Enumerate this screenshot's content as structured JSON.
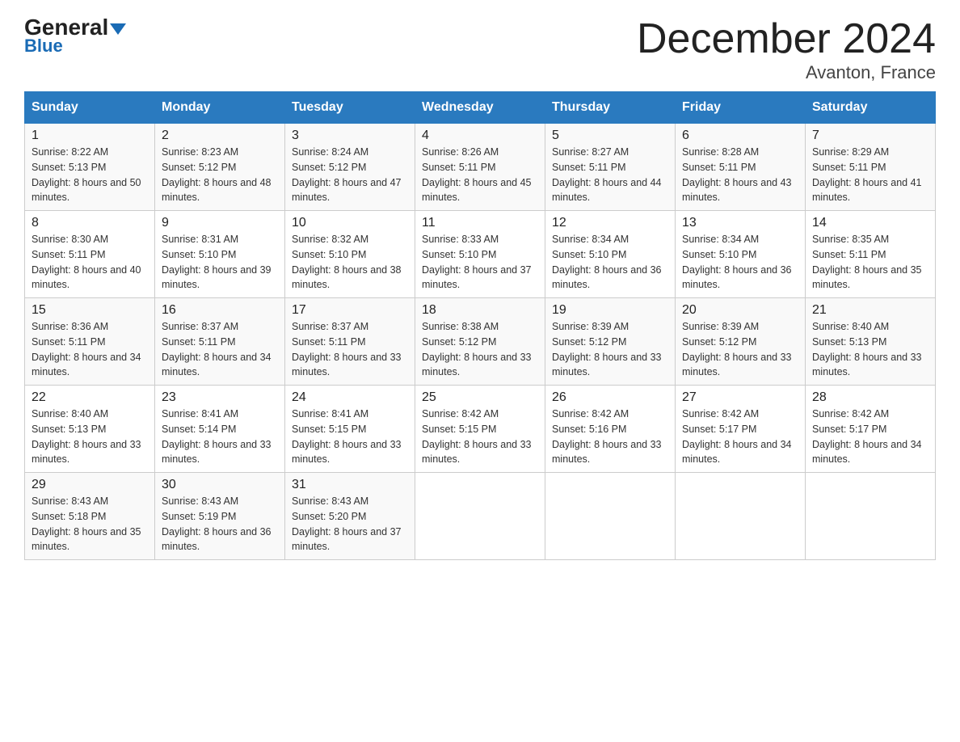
{
  "logo": {
    "general": "General",
    "blue": "Blue"
  },
  "title": "December 2024",
  "location": "Avanton, France",
  "days_header": [
    "Sunday",
    "Monday",
    "Tuesday",
    "Wednesday",
    "Thursday",
    "Friday",
    "Saturday"
  ],
  "weeks": [
    [
      {
        "day": "1",
        "sunrise": "8:22 AM",
        "sunset": "5:13 PM",
        "daylight": "8 hours and 50 minutes."
      },
      {
        "day": "2",
        "sunrise": "8:23 AM",
        "sunset": "5:12 PM",
        "daylight": "8 hours and 48 minutes."
      },
      {
        "day": "3",
        "sunrise": "8:24 AM",
        "sunset": "5:12 PM",
        "daylight": "8 hours and 47 minutes."
      },
      {
        "day": "4",
        "sunrise": "8:26 AM",
        "sunset": "5:11 PM",
        "daylight": "8 hours and 45 minutes."
      },
      {
        "day": "5",
        "sunrise": "8:27 AM",
        "sunset": "5:11 PM",
        "daylight": "8 hours and 44 minutes."
      },
      {
        "day": "6",
        "sunrise": "8:28 AM",
        "sunset": "5:11 PM",
        "daylight": "8 hours and 43 minutes."
      },
      {
        "day": "7",
        "sunrise": "8:29 AM",
        "sunset": "5:11 PM",
        "daylight": "8 hours and 41 minutes."
      }
    ],
    [
      {
        "day": "8",
        "sunrise": "8:30 AM",
        "sunset": "5:11 PM",
        "daylight": "8 hours and 40 minutes."
      },
      {
        "day": "9",
        "sunrise": "8:31 AM",
        "sunset": "5:10 PM",
        "daylight": "8 hours and 39 minutes."
      },
      {
        "day": "10",
        "sunrise": "8:32 AM",
        "sunset": "5:10 PM",
        "daylight": "8 hours and 38 minutes."
      },
      {
        "day": "11",
        "sunrise": "8:33 AM",
        "sunset": "5:10 PM",
        "daylight": "8 hours and 37 minutes."
      },
      {
        "day": "12",
        "sunrise": "8:34 AM",
        "sunset": "5:10 PM",
        "daylight": "8 hours and 36 minutes."
      },
      {
        "day": "13",
        "sunrise": "8:34 AM",
        "sunset": "5:10 PM",
        "daylight": "8 hours and 36 minutes."
      },
      {
        "day": "14",
        "sunrise": "8:35 AM",
        "sunset": "5:11 PM",
        "daylight": "8 hours and 35 minutes."
      }
    ],
    [
      {
        "day": "15",
        "sunrise": "8:36 AM",
        "sunset": "5:11 PM",
        "daylight": "8 hours and 34 minutes."
      },
      {
        "day": "16",
        "sunrise": "8:37 AM",
        "sunset": "5:11 PM",
        "daylight": "8 hours and 34 minutes."
      },
      {
        "day": "17",
        "sunrise": "8:37 AM",
        "sunset": "5:11 PM",
        "daylight": "8 hours and 33 minutes."
      },
      {
        "day": "18",
        "sunrise": "8:38 AM",
        "sunset": "5:12 PM",
        "daylight": "8 hours and 33 minutes."
      },
      {
        "day": "19",
        "sunrise": "8:39 AM",
        "sunset": "5:12 PM",
        "daylight": "8 hours and 33 minutes."
      },
      {
        "day": "20",
        "sunrise": "8:39 AM",
        "sunset": "5:12 PM",
        "daylight": "8 hours and 33 minutes."
      },
      {
        "day": "21",
        "sunrise": "8:40 AM",
        "sunset": "5:13 PM",
        "daylight": "8 hours and 33 minutes."
      }
    ],
    [
      {
        "day": "22",
        "sunrise": "8:40 AM",
        "sunset": "5:13 PM",
        "daylight": "8 hours and 33 minutes."
      },
      {
        "day": "23",
        "sunrise": "8:41 AM",
        "sunset": "5:14 PM",
        "daylight": "8 hours and 33 minutes."
      },
      {
        "day": "24",
        "sunrise": "8:41 AM",
        "sunset": "5:15 PM",
        "daylight": "8 hours and 33 minutes."
      },
      {
        "day": "25",
        "sunrise": "8:42 AM",
        "sunset": "5:15 PM",
        "daylight": "8 hours and 33 minutes."
      },
      {
        "day": "26",
        "sunrise": "8:42 AM",
        "sunset": "5:16 PM",
        "daylight": "8 hours and 33 minutes."
      },
      {
        "day": "27",
        "sunrise": "8:42 AM",
        "sunset": "5:17 PM",
        "daylight": "8 hours and 34 minutes."
      },
      {
        "day": "28",
        "sunrise": "8:42 AM",
        "sunset": "5:17 PM",
        "daylight": "8 hours and 34 minutes."
      }
    ],
    [
      {
        "day": "29",
        "sunrise": "8:43 AM",
        "sunset": "5:18 PM",
        "daylight": "8 hours and 35 minutes."
      },
      {
        "day": "30",
        "sunrise": "8:43 AM",
        "sunset": "5:19 PM",
        "daylight": "8 hours and 36 minutes."
      },
      {
        "day": "31",
        "sunrise": "8:43 AM",
        "sunset": "5:20 PM",
        "daylight": "8 hours and 37 minutes."
      },
      null,
      null,
      null,
      null
    ]
  ]
}
